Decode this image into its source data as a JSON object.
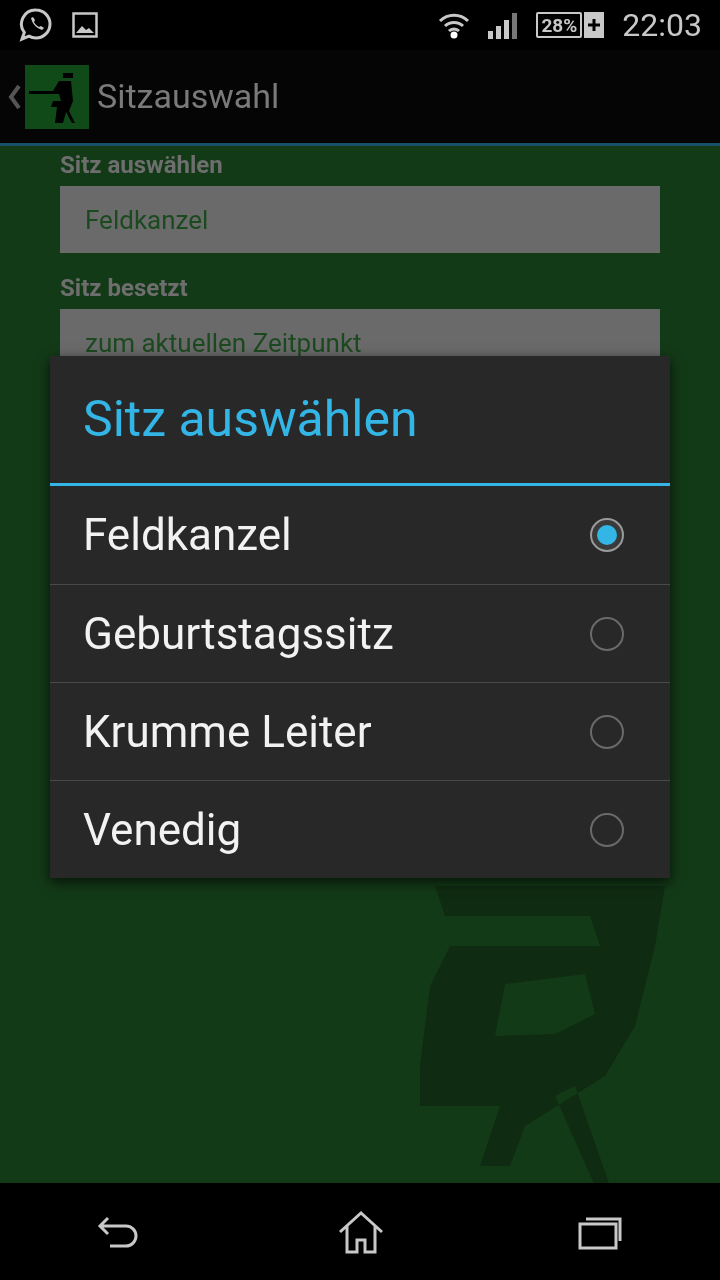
{
  "status_bar": {
    "battery": "28%",
    "time": "22:03"
  },
  "action_bar": {
    "title": "Sitzauswahl"
  },
  "form": {
    "fields": [
      {
        "label": "Sitz auswählen",
        "value": "Feldkanzel"
      },
      {
        "label": "Sitz besetzt",
        "value": "zum aktuellen Zeitpunkt"
      }
    ]
  },
  "dialog": {
    "title": "Sitz auswählen",
    "options": [
      {
        "label": "Feldkanzel",
        "selected": true
      },
      {
        "label": "Geburtstagssitz",
        "selected": false
      },
      {
        "label": "Krumme Leiter",
        "selected": false
      },
      {
        "label": "Venedig",
        "selected": false
      }
    ]
  }
}
